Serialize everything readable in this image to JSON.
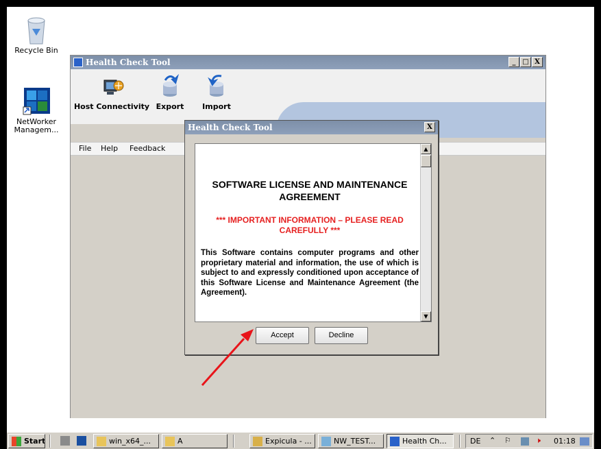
{
  "desktop": {
    "icons": [
      {
        "label": "Recycle Bin"
      },
      {
        "label": "NetWorker Managem..."
      }
    ]
  },
  "main_window": {
    "title": "Health Check Tool",
    "controls": {
      "minimize": "_",
      "maximize": "□",
      "close": "X"
    },
    "toolbar": [
      {
        "label": "Host Connectivity",
        "icon": "host-connectivity-icon"
      },
      {
        "label": "Export",
        "icon": "export-icon"
      },
      {
        "label": "Import",
        "icon": "import-icon"
      }
    ],
    "menu": [
      "File",
      "Help",
      "Feedback"
    ]
  },
  "dialog": {
    "title": "Health Check Tool",
    "close": "X",
    "heading": "SOFTWARE LICENSE AND MAINTENANCE AGREEMENT",
    "important": "*** IMPORTANT INFORMATION – PLEASE READ CAREFULLY ***",
    "body": "This Software contains computer programs and other proprietary material and information, the use of which is subject to and expressly conditioned upon acceptance of this Software License and Maintenance Agreement (the Agreement).",
    "buttons": {
      "accept": "Accept",
      "decline": "Decline"
    }
  },
  "taskbar": {
    "start": "Start",
    "items": [
      {
        "label": "win_x64_..."
      },
      {
        "label": "A"
      },
      {
        "label": "Expicula - ..."
      },
      {
        "label": "NW_TEST..."
      },
      {
        "label": "Health Ch...",
        "active": true
      }
    ],
    "language": "DE",
    "clock": "01:18"
  },
  "colors": {
    "titlebar": "#8497b1",
    "warning_red": "#e62020",
    "arrow_red": "#e8141a",
    "banner": "#b3c5df"
  }
}
